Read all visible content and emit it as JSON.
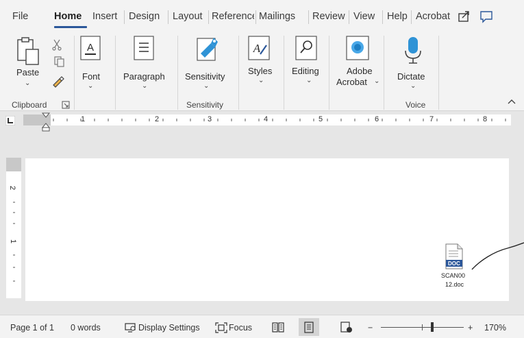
{
  "tabs": [
    {
      "label": "File",
      "active": false
    },
    {
      "label": "Home",
      "active": true
    },
    {
      "label": "Insert",
      "active": false
    },
    {
      "label": "Design",
      "active": false
    },
    {
      "label": "Layout",
      "active": false
    },
    {
      "label": "Reference",
      "active": false
    },
    {
      "label": "Mailings",
      "active": false
    },
    {
      "label": "Review",
      "active": false
    },
    {
      "label": "View",
      "active": false
    },
    {
      "label": "Help",
      "active": false
    },
    {
      "label": "Acrobat",
      "active": false
    }
  ],
  "top_buttons": {
    "share": "share-icon",
    "comments": "comment-icon"
  },
  "ribbon": {
    "paste": "Paste",
    "font": "Font",
    "paragraph": "Paragraph",
    "sensitivity": "Sensitivity",
    "styles": "Styles",
    "editing": "Editing",
    "adobe_line1": "Adobe",
    "adobe_line2": "Acrobat",
    "dictate": "Dictate",
    "chevron": "⌄",
    "groups": {
      "clipboard": "Clipboard",
      "sensitivity": "Sensitivity",
      "voice": "Voice"
    },
    "accent": "#2b579a"
  },
  "ruler": {
    "numbers": [
      "1",
      "2",
      "3",
      "4",
      "5",
      "6",
      "7",
      "8"
    ]
  },
  "vertical_ruler": {
    "numbers": [
      "2",
      "1"
    ]
  },
  "document": {
    "file_icon": {
      "badge": "DOC",
      "name_line1": "SCAN00",
      "name_line2": "12.doc"
    }
  },
  "status": {
    "page": "Page 1 of 1",
    "words": "0 words",
    "display_settings": "Display Settings",
    "focus": "Focus",
    "zoom_minus": "−",
    "zoom_plus": "+",
    "zoom": "170%",
    "zoom_level": 0.62
  }
}
